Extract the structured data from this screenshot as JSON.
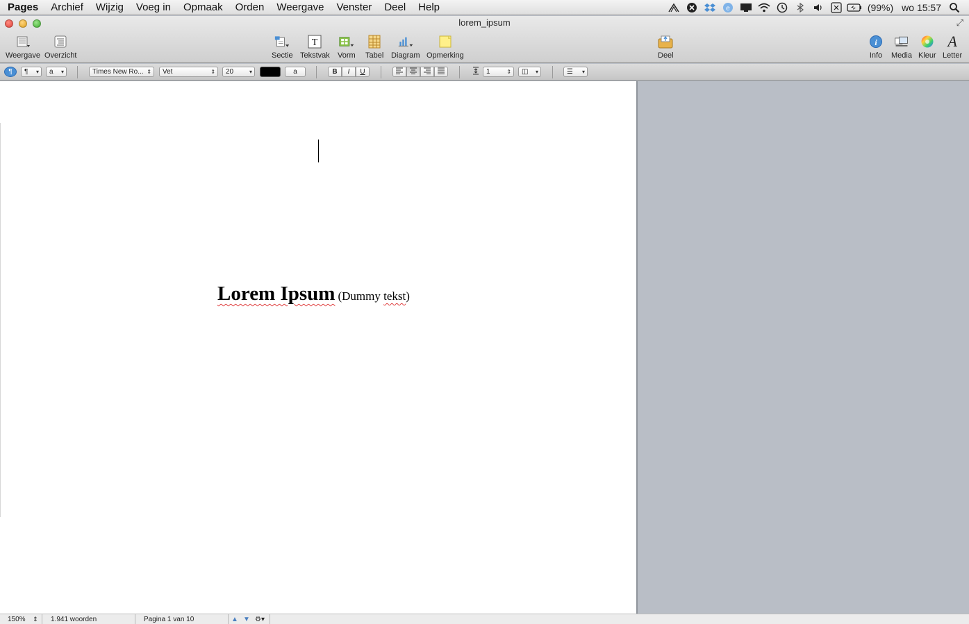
{
  "menubar": {
    "app": "Pages",
    "items": [
      "Archief",
      "Wijzig",
      "Voeg in",
      "Opmaak",
      "Orden",
      "Weergave",
      "Venster",
      "Deel",
      "Help"
    ],
    "battery": "(99%)",
    "clock": "wo 15:57",
    "tray_icons": [
      "airport-icon",
      "x-icon",
      "dropbox-icon",
      "app-icon",
      "display-icon",
      "wifi-icon",
      "timemachine-icon",
      "bluetooth-icon",
      "volume-icon",
      "keyboard-icon",
      "battery-icon",
      "spotlight-icon"
    ]
  },
  "window": {
    "title": "lorem_ipsum"
  },
  "toolbar": {
    "weergave": "Weergave",
    "overzicht": "Overzicht",
    "sectie": "Sectie",
    "tekstvak": "Tekstvak",
    "vorm": "Vorm",
    "tabel": "Tabel",
    "diagram": "Diagram",
    "opmerking": "Opmerking",
    "deel": "Deel",
    "info": "Info",
    "media": "Media",
    "kleur": "Kleur",
    "letter": "Letter"
  },
  "formatbar": {
    "paragraph_style": "¶",
    "char_style": "a",
    "font": "Times New Ro...",
    "typeface": "Vet",
    "size": "20",
    "text_color": "#000000",
    "bg_label": "a",
    "bold": "B",
    "italic": "I",
    "underline": "U",
    "line_spacing": "1"
  },
  "document": {
    "title": "Lorem Ipsum",
    "subtitle_open": "(Dummy ",
    "subtitle_word": "tekst",
    "subtitle_close": ")"
  },
  "statusbar": {
    "zoom": "150%",
    "word_count": "1.941 woorden",
    "page": "Pagina 1 van 10"
  }
}
